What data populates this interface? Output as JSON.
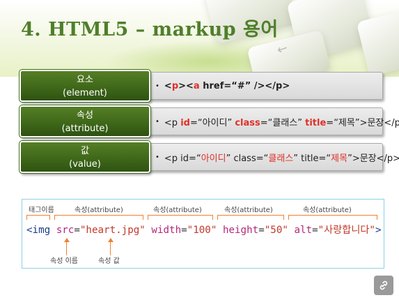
{
  "title": "4. HTML5 – markup 용어",
  "terms": [
    {
      "label_ko": "요소",
      "label_en": "(element)",
      "example": [
        {
          "t": "<",
          "c": "bold"
        },
        {
          "t": "p",
          "c": "bold red"
        },
        {
          "t": "><",
          "c": "bold"
        },
        {
          "t": "a",
          "c": "bold red"
        },
        {
          "t": " href=“#” /></p>",
          "c": "bold"
        }
      ]
    },
    {
      "label_ko": "속성",
      "label_en": "(attribute)",
      "example": [
        {
          "t": "<p ",
          "c": ""
        },
        {
          "t": "id",
          "c": "bold red"
        },
        {
          "t": "=“아이디” ",
          "c": ""
        },
        {
          "t": "class",
          "c": "bold red"
        },
        {
          "t": "=“클래스” ",
          "c": ""
        },
        {
          "t": "title",
          "c": "bold red"
        },
        {
          "t": "=“제목”>문장</p>",
          "c": ""
        }
      ]
    },
    {
      "label_ko": "값",
      "label_en": "(value)",
      "example": [
        {
          "t": "<p id=“",
          "c": ""
        },
        {
          "t": "아이디",
          "c": "red"
        },
        {
          "t": "” class=“",
          "c": ""
        },
        {
          "t": "클래스",
          "c": "red"
        },
        {
          "t": "” title=“",
          "c": ""
        },
        {
          "t": "제목",
          "c": "red"
        },
        {
          "t": "”>문장</p>",
          "c": ""
        }
      ]
    }
  ],
  "diagram": {
    "headers": {
      "tag_name": "태그이름",
      "attr1": "속성(attribute)",
      "attr2": "속성(attribute)",
      "attr3": "속성(attribute)",
      "attr4": "속성(attribute)"
    },
    "code": {
      "tag": "<img",
      "a1_name": "src",
      "a1_value": "\"heart.jpg\"",
      "a2_name": "width",
      "a2_value": "\"100\"",
      "a3_name": "height",
      "a3_value": "\"50\"",
      "a4_name": "alt",
      "a4_value": "\"사랑합니다\"",
      "close": ">"
    },
    "annotations": {
      "attr_name": "속성 이름",
      "attr_value": "속성 값"
    }
  },
  "icons": {
    "link": "link-icon"
  }
}
